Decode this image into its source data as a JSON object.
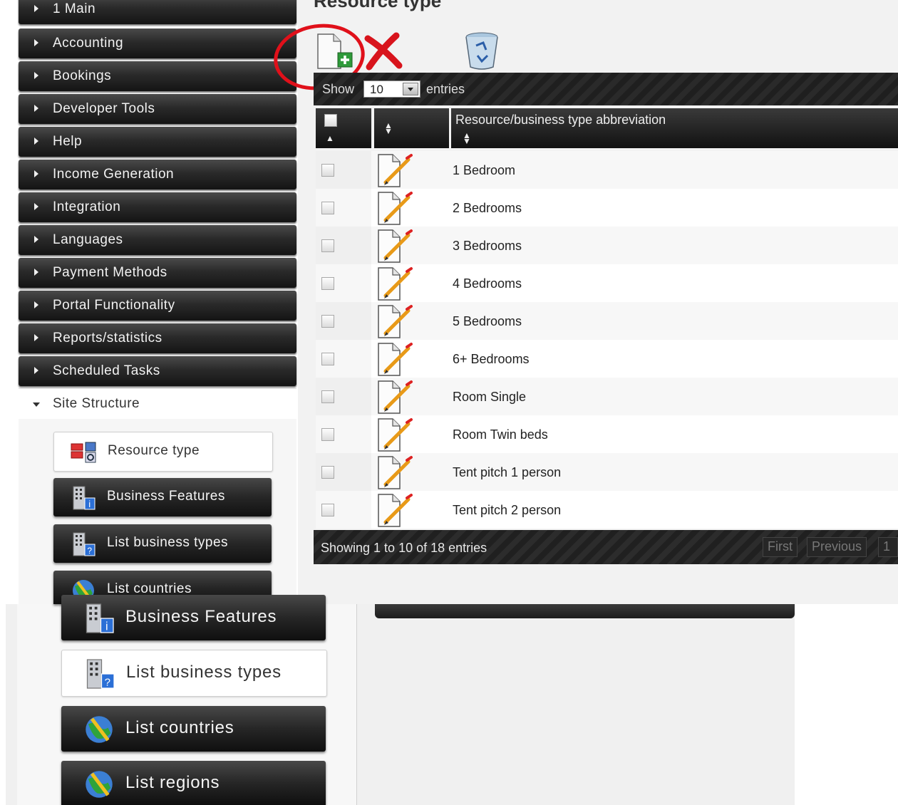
{
  "page": {
    "title": "Resource type"
  },
  "sidebar": {
    "items": [
      {
        "label": "1 Main"
      },
      {
        "label": "Accounting"
      },
      {
        "label": "Bookings"
      },
      {
        "label": "Developer Tools"
      },
      {
        "label": "Help"
      },
      {
        "label": "Income Generation"
      },
      {
        "label": "Integration"
      },
      {
        "label": "Languages"
      },
      {
        "label": "Payment Methods"
      },
      {
        "label": "Portal Functionality"
      },
      {
        "label": "Reports/statistics"
      },
      {
        "label": "Scheduled Tasks"
      },
      {
        "label": "Site Structure"
      }
    ],
    "sub_items": [
      {
        "label": "Resource type",
        "icon": "resource-type-icon"
      },
      {
        "label": "Business Features",
        "icon": "business-features-icon"
      },
      {
        "label": "List business types",
        "icon": "list-business-types-icon"
      },
      {
        "label": "List countries",
        "icon": "globe-icon"
      }
    ]
  },
  "zoomed_panel": {
    "items": [
      {
        "label": "Business Features",
        "icon": "business-features-icon"
      },
      {
        "label": "List business types",
        "icon": "list-business-types-icon"
      },
      {
        "label": "List countries",
        "icon": "globe-icon"
      },
      {
        "label": "List regions",
        "icon": "globe-icon"
      }
    ]
  },
  "toolbar": {
    "icons": [
      "new-document-icon",
      "delete-icon",
      "recycle-bin-icon"
    ],
    "annotation_color": "#e0101a"
  },
  "table": {
    "show_label": "Show",
    "entries_value": "10",
    "entries_label": "entries",
    "columns": [
      "",
      "",
      "Resource/business type abbreviation"
    ],
    "rows": [
      {
        "abbr": "1 Bedroom"
      },
      {
        "abbr": "2 Bedrooms"
      },
      {
        "abbr": "3 Bedrooms"
      },
      {
        "abbr": "4 Bedrooms"
      },
      {
        "abbr": "5 Bedrooms"
      },
      {
        "abbr": "6+ Bedrooms"
      },
      {
        "abbr": "Room Single"
      },
      {
        "abbr": "Room Twin beds"
      },
      {
        "abbr": "Tent pitch 1 person"
      },
      {
        "abbr": "Tent pitch 2 person"
      }
    ],
    "info": "Showing 1 to 10 of 18 entries",
    "pager": {
      "first": "First",
      "previous": "Previous",
      "page": "1"
    }
  }
}
